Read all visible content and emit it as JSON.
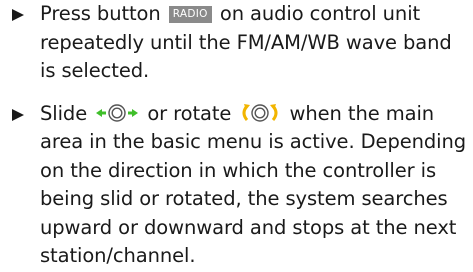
{
  "steps": [
    {
      "text_before": "Press button",
      "button_label": "RADIO",
      "text_after": "on audio control unit repeatedly until the FM/AM/WB wave band is selected."
    },
    {
      "text_before": "Slide",
      "text_middle": "or rotate",
      "text_after": "when the main area in the basic menu is active. Depending on the direction in which the controller is being slid or rotated, the system searches upward or downward and stops at the next station/channel."
    }
  ],
  "icons": {
    "step_marker": "triangle-bullet-icon",
    "slide_control": "slide-left-right-controller-icon",
    "rotate_control": "rotate-controller-icon"
  },
  "colors": {
    "text": "#1a1a1a",
    "button_background": "#8a8a8a",
    "button_text": "#ffffff",
    "control_arrow": "#3fbf2a",
    "rotate_arrow": "#f2b500",
    "controller_ring": "#555555"
  }
}
